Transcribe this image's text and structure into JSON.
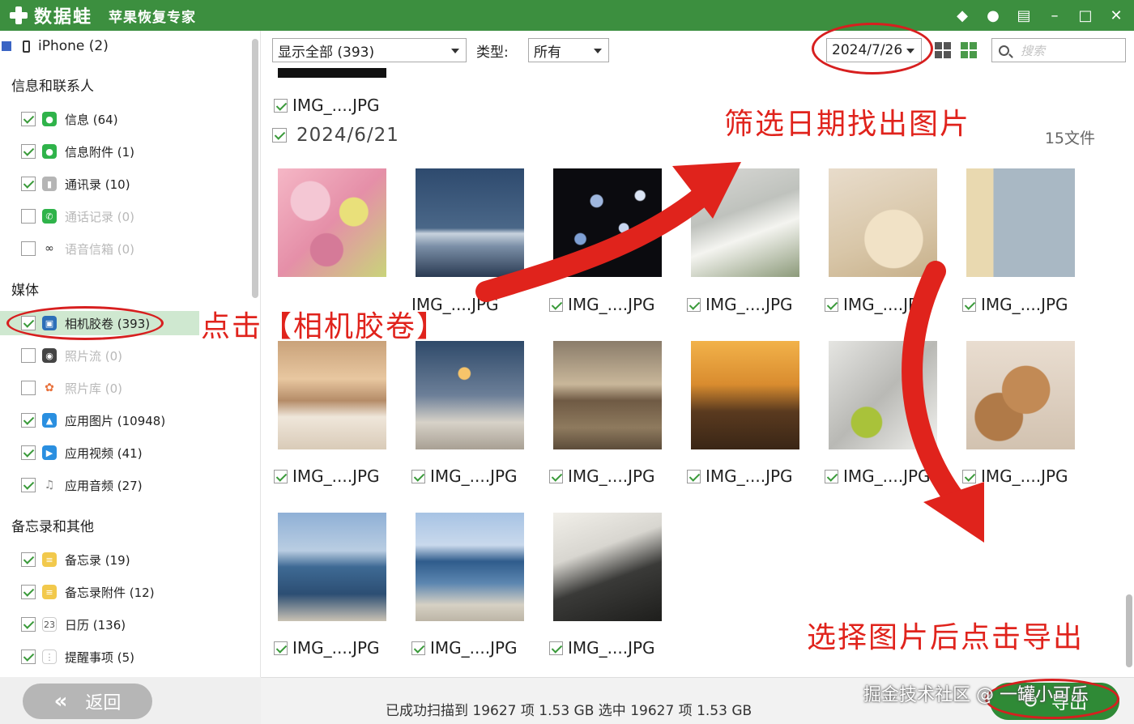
{
  "app": {
    "name": "数据蛙",
    "subtitle": "苹果恢复专家"
  },
  "sidebar": {
    "device": "iPhone (2)",
    "sections": [
      {
        "title": "信息和联系人",
        "items": [
          {
            "label": "信息 (64)",
            "checked": true,
            "icon": "message-icon",
            "color": "#2fb34a",
            "dim": false
          },
          {
            "label": "信息附件 (1)",
            "checked": true,
            "icon": "attachment-icon",
            "color": "#2fb34a",
            "dim": false
          },
          {
            "label": "通讯录 (10)",
            "checked": true,
            "icon": "contacts-icon",
            "color": "#9a9a9a",
            "dim": false
          },
          {
            "label": "通话记录 (0)",
            "checked": false,
            "icon": "phone-icon",
            "color": "#2fb34a",
            "dim": true
          },
          {
            "label": "语音信箱 (0)",
            "checked": false,
            "icon": "voicemail-icon",
            "color": "#555555",
            "dim": true
          }
        ]
      },
      {
        "title": "媒体",
        "items": [
          {
            "label": "相机胶卷 (393)",
            "checked": true,
            "icon": "camera-roll-icon",
            "color": "#2d6fb8",
            "dim": false,
            "active": true
          },
          {
            "label": "照片流 (0)",
            "checked": false,
            "icon": "photo-stream-icon",
            "color": "#444444",
            "dim": true
          },
          {
            "label": "照片库 (0)",
            "checked": false,
            "icon": "photo-library-icon",
            "color": "#e8703a",
            "dim": true
          },
          {
            "label": "应用图片 (10948)",
            "checked": true,
            "icon": "app-photo-icon",
            "color": "#2a8fe0",
            "dim": false
          },
          {
            "label": "应用视频 (41)",
            "checked": true,
            "icon": "app-video-icon",
            "color": "#2a8fe0",
            "dim": false
          },
          {
            "label": "应用音频 (27)",
            "checked": true,
            "icon": "app-audio-icon",
            "color": "#888888",
            "dim": false
          }
        ]
      },
      {
        "title": "备忘录和其他",
        "items": [
          {
            "label": "备忘录 (19)",
            "checked": true,
            "icon": "notes-icon",
            "color": "#f2c94c",
            "dim": false
          },
          {
            "label": "备忘录附件 (12)",
            "checked": true,
            "icon": "notes-attachment-icon",
            "color": "#f2c94c",
            "dim": false
          },
          {
            "label": "日历 (136)",
            "checked": true,
            "icon": "calendar-icon",
            "color": "#888888",
            "dim": false
          },
          {
            "label": "提醒事项 (5)",
            "checked": true,
            "icon": "reminders-icon",
            "color": "#999999",
            "dim": false
          }
        ]
      }
    ],
    "back_label": "返回"
  },
  "toolbar": {
    "filter_value": "显示全部 (393)",
    "type_label": "类型:",
    "type_value": "所有",
    "date_value": "2024/7/26",
    "search_placeholder": "搜索"
  },
  "content": {
    "prev_file": "IMG_....JPG",
    "group_date": "2024/6/21",
    "group_count": "15文件",
    "file_label": "IMG_....JPG"
  },
  "status": {
    "text": "已成功扫描到 19627 项 1.53 GB  选中 19627 项 1.53 GB",
    "export_label": "导出"
  },
  "annotations": {
    "click_camera_roll": "点击【相机胶卷】",
    "filter_date": "筛选日期找出图片",
    "select_export": "选择图片后点击导出"
  },
  "watermark": "掘金技术社区 @ 一罐小可乐",
  "colors": {
    "brand_green": "#3c8f3f",
    "annotation_red": "#e0231c",
    "active_row": "#cfe8d0"
  }
}
